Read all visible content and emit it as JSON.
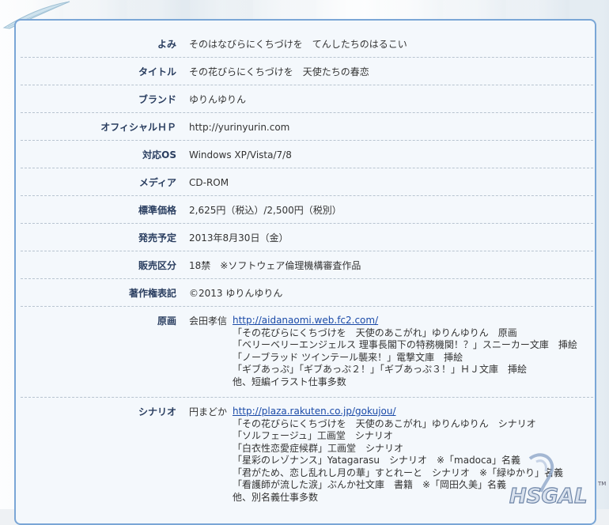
{
  "rows": [
    {
      "label": "よみ",
      "value": "そのはなびらにくちづけを　てんしたちのはるこい"
    },
    {
      "label": "タイトル",
      "value": "その花びらにくちづけを　天使たちの春恋"
    },
    {
      "label": "ブランド",
      "value": "ゆりんゆりん"
    },
    {
      "label": "オフィシャルＨＰ",
      "value": "http://yurinyurin.com"
    },
    {
      "label": "対応OS",
      "value": "Windows XP/Vista/7/8"
    },
    {
      "label": "メディア",
      "value": "CD-ROM"
    },
    {
      "label": "標準価格",
      "value": "2,625円（税込）/2,500円（税別）"
    },
    {
      "label": "発売予定",
      "value": "2013年8月30日（金）"
    },
    {
      "label": "販売区分",
      "value": "18禁　※ソフトウェア倫理機構審査作品"
    },
    {
      "label": "著作権表記",
      "value": "©2013 ゆりんゆりん"
    }
  ],
  "art": {
    "label": "原画",
    "name": "会田孝信",
    "link": "http://aidanaomi.web.fc2.com/",
    "works": [
      "「その花びらにくちづけを　天使のあこがれ」ゆりんゆりん　原画",
      "「ベリーベリーエンジェルス 理事長閣下の特務機関！？」スニーカー文庫　挿絵",
      "「ノーブラッド ツインテール襲来！」電撃文庫　挿絵",
      "「ギブあっぷ」「ギブあっぷ２！」「ギブあっぷ３！」ＨＪ文庫　挿絵",
      "他、短編イラスト仕事多数"
    ]
  },
  "scenario": {
    "label": "シナリオ",
    "name": "円まどか",
    "link": "http://plaza.rakuten.co.jp/gokujou/",
    "works": [
      "「その花びらにくちづけを　天使のあこがれ」ゆりんゆりん　シナリオ",
      "「ソルフェージュ」工画堂　シナリオ",
      "「白衣性恋愛症候群」工画堂　シナリオ",
      "「星彩のレゾナンス」Yatagarasu　シナリオ　※「madoca」名義",
      "「君がため、恋し乱れし月の華」すとれーと　シナリオ　※「緑ゆかり」名義",
      "「看護師が流した涙」ぶんか社文庫　書籍　※「岡田久美」名義",
      "他、別名義仕事多数"
    ]
  },
  "watermark": "HSGAL",
  "watermark_tm": "TM"
}
